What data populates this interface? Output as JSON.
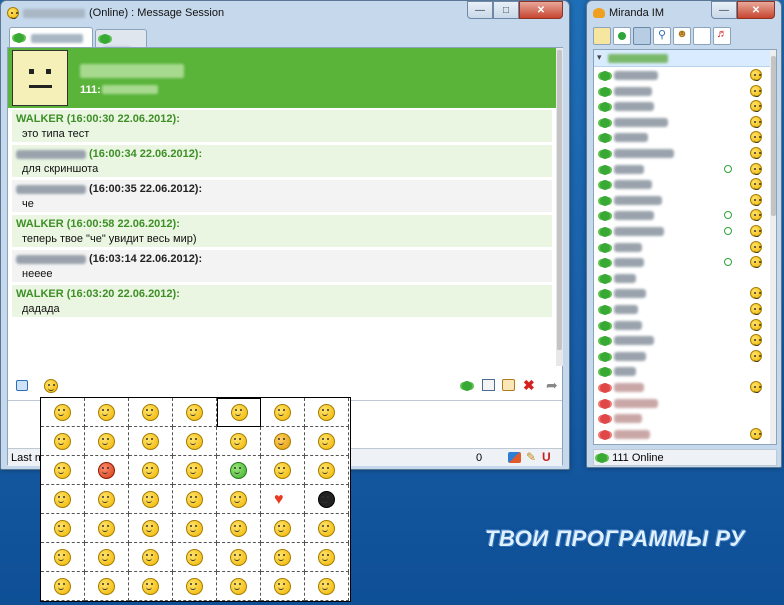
{
  "message_window": {
    "title_status": "(Online) : Message Session",
    "contact_id_prefix": "111:",
    "messages": [
      {
        "sender": "WALKER",
        "time": "(16:00:30 22.06.2012):",
        "text": "это типа тест",
        "own": true
      },
      {
        "sender": "",
        "time": "(16:00:34 22.06.2012):",
        "text": "для скриншота",
        "own": true
      },
      {
        "sender": "",
        "time": "(16:00:35 22.06.2012):",
        "text": "че",
        "own": false
      },
      {
        "sender": "WALKER",
        "time": "(16:00:58 22.06.2012):",
        "text": "теперь твое \"че\" увидит весь мир)",
        "own": true
      },
      {
        "sender": "",
        "time": "(16:03:14 22.06.2012):",
        "text": "нееее",
        "own": false
      },
      {
        "sender": "WALKER",
        "time": "(16:03:20 22.06.2012):",
        "text": "дадада",
        "own": true
      }
    ],
    "status_left": "Last m",
    "status_count": "0"
  },
  "miranda": {
    "title": "Miranda IM",
    "status": "111 Online"
  },
  "watermark": "ТВОИ ПРОГРАММЫ РУ",
  "colors": {
    "accent_green": "#5db83a",
    "own_sender": "#3d8f26",
    "desktop": "#1a5fa8"
  }
}
